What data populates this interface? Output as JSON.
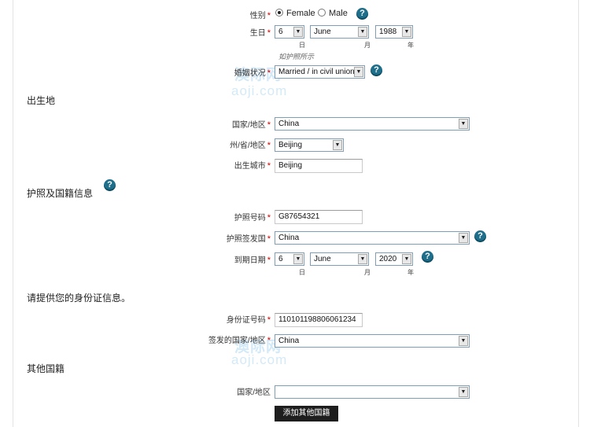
{
  "gender": {
    "label": "性别",
    "required": "*",
    "options": [
      "Female",
      "Male"
    ],
    "selected": "Female"
  },
  "birth_date": {
    "label": "生日",
    "required": "*",
    "day": "6",
    "month": "June",
    "year": "1988",
    "day_unit": "日",
    "month_unit": "月",
    "year_unit": "年",
    "hint": "如护照所示"
  },
  "marital": {
    "label": "婚姻状况",
    "required": "*",
    "value": "Married / in civil union"
  },
  "birthplace_section": "出生地",
  "birth_country": {
    "label": "国家/地区",
    "required": "*",
    "value": "China"
  },
  "birth_state": {
    "label": "州/省/地区",
    "required": "*",
    "value": "Beijing"
  },
  "birth_city": {
    "label": "出生城市",
    "required": "*",
    "value": "Beijing"
  },
  "passport_section": "护照及国籍信息",
  "passport_number": {
    "label": "护照号码",
    "required": "*",
    "value": "G87654321"
  },
  "passport_country": {
    "label": "护照签发国",
    "required": "*",
    "value": "China"
  },
  "expiry": {
    "label": "到期日期",
    "required": "*",
    "day": "6",
    "month": "June",
    "year": "2020",
    "day_unit": "日",
    "month_unit": "月",
    "year_unit": "年"
  },
  "id_section": "请提供您的身份证信息。",
  "id_number": {
    "label": "身份证号码",
    "required": "*",
    "value": "110101198806061234"
  },
  "id_country": {
    "label": "签发的国家/地区",
    "required": "*",
    "value": "China"
  },
  "other_section": "其他国籍",
  "other_country": {
    "label": "国家/地区",
    "value": ""
  },
  "add_button": "添加其他国籍",
  "watermark": {
    "cn": "澳际网",
    "en": "aoji.com"
  },
  "help_glyph": "?",
  "arrow_glyph": "▼",
  "icons": [
    "help-icon",
    "chevron-down-icon",
    "radio-selected-icon"
  ]
}
